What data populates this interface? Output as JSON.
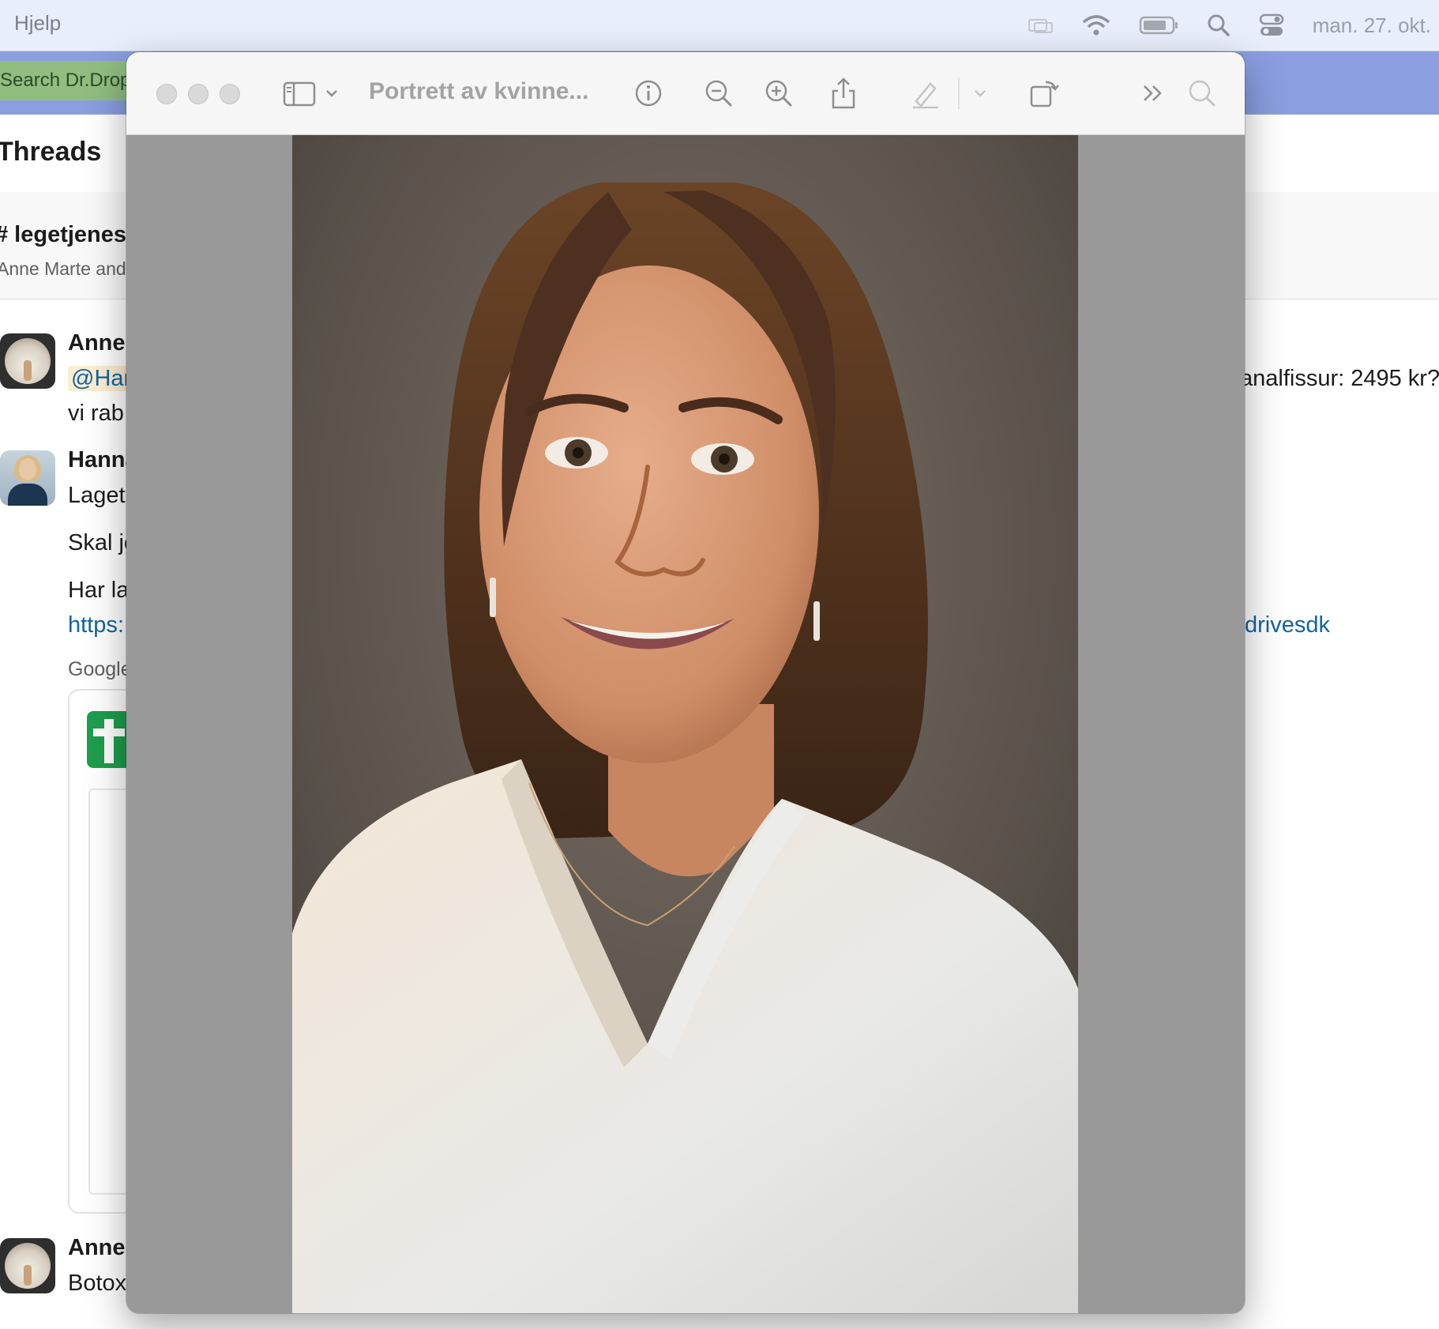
{
  "menubar": {
    "help_menu": "Hjelp",
    "date": "man. 27. okt."
  },
  "slack": {
    "search_placeholder": "Search Dr.Dropin",
    "threads_title": "Threads",
    "channel_name": "# legetjeneste",
    "participants": "Anne Marte and you",
    "messages": [
      {
        "author": "Anne",
        "mention": "@Hanna",
        "line2": "vi rab",
        "right_text": "analfissur: 2495 kr?"
      },
      {
        "author": "Hanna",
        "line1": "Laget",
        "line2": "Skal je",
        "line3": "Har la",
        "link": "https:",
        "link_tail": "drivesdk",
        "preview_source": "Google"
      },
      {
        "author": "Anne",
        "line1": "Botox"
      }
    ]
  },
  "preview": {
    "title": "Portrett av kvinne...",
    "colors": {
      "canvas": "#999999",
      "toolbar": "#f6f6f6",
      "photo_background": "#5a524b"
    }
  }
}
